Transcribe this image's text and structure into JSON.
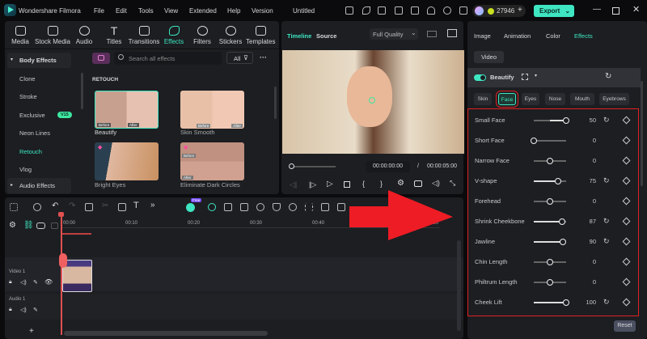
{
  "titlebar": {
    "app_name": "Wondershare Filmora",
    "menu": [
      "File",
      "Edit",
      "Tools",
      "View",
      "Extended",
      "Help",
      "Version"
    ],
    "project_title": "Untitled",
    "credits": "27946",
    "export_label": "Export"
  },
  "toolbar": {
    "items": [
      "Media",
      "Stock Media",
      "Audio",
      "Titles",
      "Transitions",
      "Effects",
      "Filters",
      "Stickers",
      "Templates"
    ],
    "active": "Effects"
  },
  "effects_sidebar": {
    "groups": [
      "Body Effects",
      "Audio Effects"
    ],
    "items": [
      {
        "label": "Clone"
      },
      {
        "label": "Stroke"
      },
      {
        "label": "Exclusive",
        "badge": "V15"
      },
      {
        "label": "Neon Lines"
      },
      {
        "label": "Retouch",
        "active": true
      },
      {
        "label": "Vlog"
      }
    ]
  },
  "effects_browser": {
    "search_placeholder": "Search all effects",
    "filter_label": "All",
    "section": "RETOUCH",
    "cards": [
      {
        "name": "Beautify",
        "before": "Before",
        "after": "After"
      },
      {
        "name": "Skin Smooth",
        "before": "Before",
        "after": "After"
      },
      {
        "name": "Bright Eyes"
      },
      {
        "name": "Eliminate Dark Circles",
        "before": "Before",
        "after": "After"
      }
    ]
  },
  "preview": {
    "tabs": [
      "Timeline",
      "Source"
    ],
    "quality": "Full Quality",
    "current_time": "00:00:00:00",
    "separator": "/",
    "total_time": "00:00:05:00",
    "progress": 0
  },
  "inspector": {
    "tabs": [
      "Image",
      "Animation",
      "Color",
      "Effects"
    ],
    "active_tab": "Effects",
    "subtab": "Video",
    "effect_name": "Beautify",
    "enabled": true,
    "categories": [
      "Skin",
      "Face",
      "Eyes",
      "Nose",
      "Mouth",
      "Eyebrows"
    ],
    "active_category": "Face",
    "sliders": [
      {
        "label": "Small Face",
        "value": "50",
        "position": 1.0,
        "fill": 0.5,
        "fill_from": 0.5,
        "reset": true
      },
      {
        "label": "Short Face",
        "value": "0",
        "position": 0.0,
        "fill": 0,
        "fill_from": 0,
        "reset": false
      },
      {
        "label": "Narrow Face",
        "value": "0",
        "position": 0.5,
        "fill": 0,
        "fill_from": 0.5,
        "reset": false
      },
      {
        "label": "V-shape",
        "value": "75",
        "position": 0.75,
        "fill": 0.75,
        "fill_from": 0,
        "reset": true
      },
      {
        "label": "Forehead",
        "value": "0",
        "position": 0.5,
        "fill": 0,
        "fill_from": 0.5,
        "reset": false
      },
      {
        "label": "Shrink Cheekbone",
        "value": "87",
        "position": 0.87,
        "fill": 0.87,
        "fill_from": 0,
        "reset": true
      },
      {
        "label": "Jawline",
        "value": "90",
        "position": 0.9,
        "fill": 0.9,
        "fill_from": 0,
        "reset": true
      },
      {
        "label": "Chin Length",
        "value": "0",
        "position": 0.5,
        "fill": 0,
        "fill_from": 0.5,
        "reset": false
      },
      {
        "label": "Philtrum Length",
        "value": "0",
        "position": 0.5,
        "fill": 0,
        "fill_from": 0.5,
        "reset": false
      },
      {
        "label": "Cheek Lift",
        "value": "100",
        "position": 1.0,
        "fill": 1.0,
        "fill_from": 0,
        "reset": true
      }
    ],
    "reset_label": "Reset"
  },
  "timeline": {
    "ruler": [
      "00:00",
      "00:10",
      "00:20",
      "00:30",
      "00:40",
      "01:00"
    ],
    "tracks": [
      "Video 1",
      "Audio 1"
    ],
    "ai_badge": "Free"
  },
  "colors": {
    "accent": "#3ee6c1",
    "highlight_red": "#e02020",
    "arrow": "#ee1c24"
  }
}
